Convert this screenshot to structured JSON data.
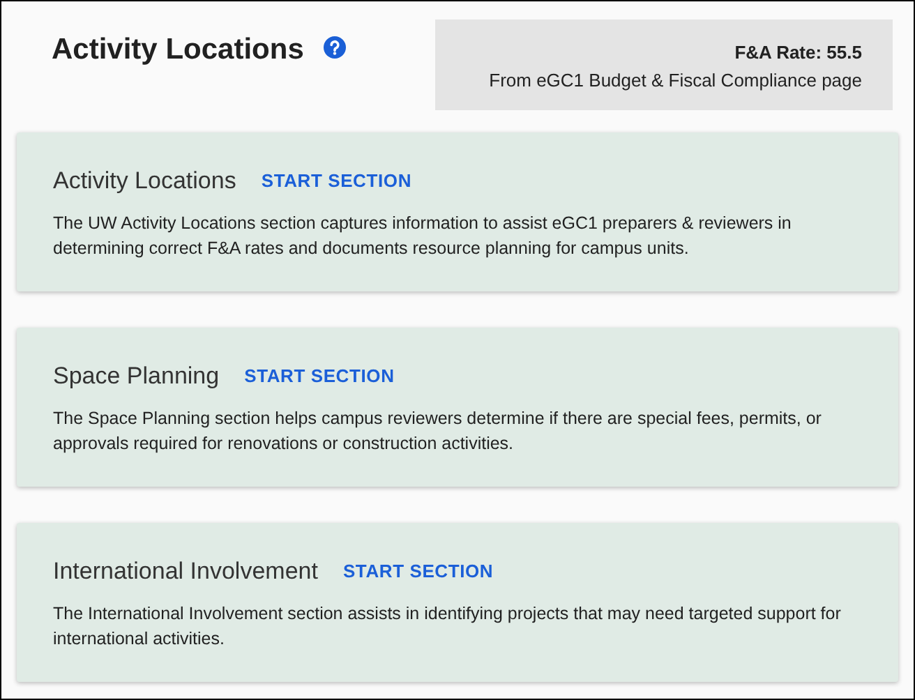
{
  "header": {
    "title": "Activity Locations",
    "rate": {
      "label": "F&A Rate: 55.5",
      "source": "From eGC1 Budget & Fiscal Compliance page"
    }
  },
  "sections": [
    {
      "title": "Activity Locations",
      "action": "START SECTION",
      "description": "The UW Activity Locations section captures information to assist eGC1 preparers & reviewers in determining correct F&A rates and documents resource planning for campus units."
    },
    {
      "title": "Space Planning",
      "action": "START SECTION",
      "description": "The Space Planning section helps campus reviewers determine if there are special fees, permits, or approvals required for renovations or construction activities."
    },
    {
      "title": "International Involvement",
      "action": "START SECTION",
      "description": "The International Involvement section assists in identifying projects that may need targeted support for international activities."
    }
  ]
}
